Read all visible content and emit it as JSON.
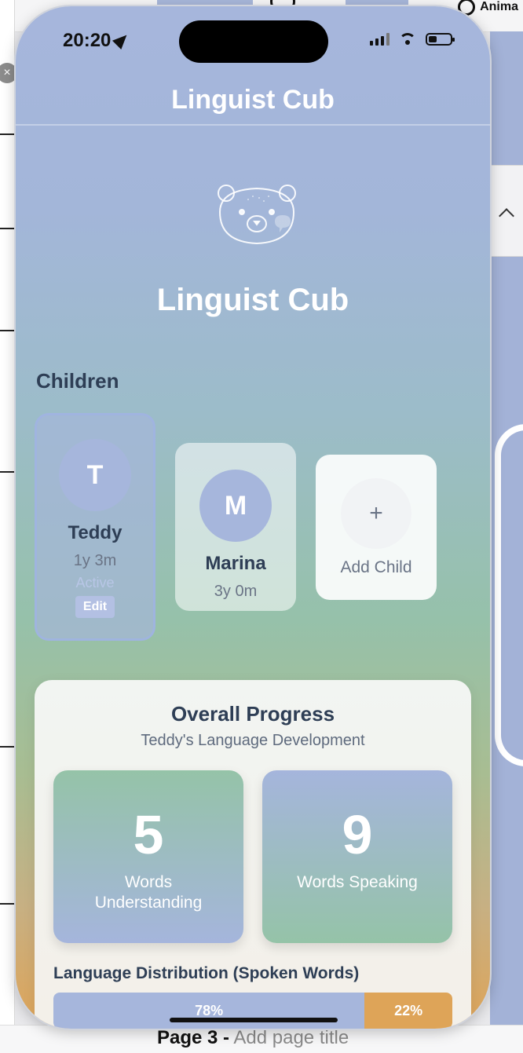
{
  "background": {
    "top_right_label": "Anima",
    "bottom_label_bold": "Page 3 -",
    "bottom_label_rest": " Add page title",
    "close_glyph": "×"
  },
  "status_bar": {
    "time": "20:20"
  },
  "nav": {
    "title": "Linguist Cub"
  },
  "hero": {
    "title": "Linguist Cub",
    "icon": "bear-face-icon"
  },
  "children": {
    "section_title": "Children",
    "items": [
      {
        "initial": "T",
        "name": "Teddy",
        "age": "1y 3m",
        "status": "Active",
        "edit_label": "Edit"
      },
      {
        "initial": "M",
        "name": "Marina",
        "age": "3y 0m"
      }
    ],
    "add": {
      "glyph": "+",
      "label": "Add Child"
    }
  },
  "progress": {
    "title": "Overall Progress",
    "subtitle": "Teddy's Language Development",
    "stats": [
      {
        "value": "5",
        "label": "Words Understanding"
      },
      {
        "value": "9",
        "label": "Words Speaking"
      }
    ],
    "distribution": {
      "title": "Language Distribution (Spoken Words)",
      "segments": [
        {
          "label": "78%",
          "value": 78,
          "color": "#a6b6dc"
        },
        {
          "label": "22%",
          "value": 22,
          "color": "#dea458"
        }
      ]
    }
  },
  "colors": {
    "accent": "#a6b6dc",
    "green": "#95c3a8",
    "orange": "#dea458",
    "text": "#2e3e55"
  }
}
